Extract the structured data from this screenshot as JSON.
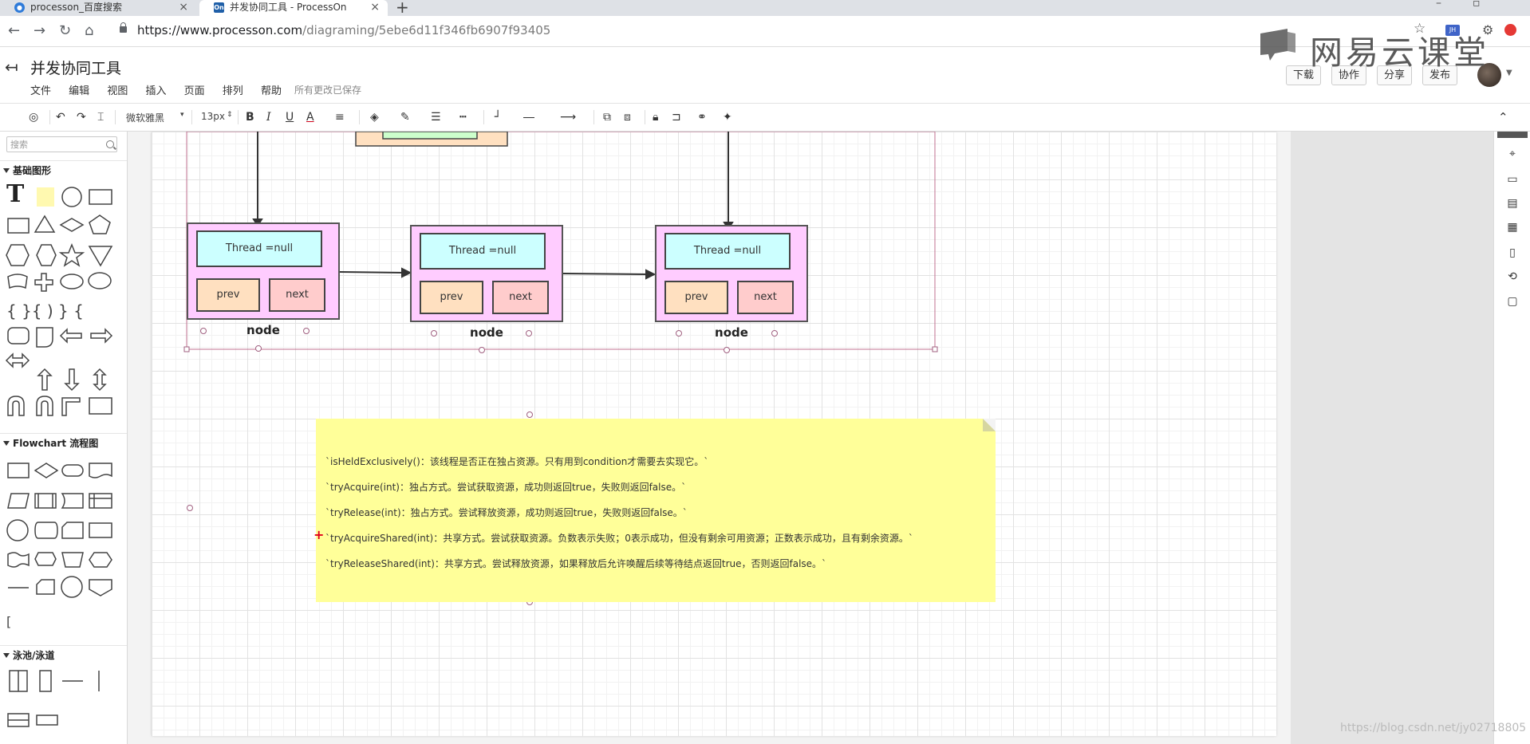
{
  "browser": {
    "tabs": [
      {
        "label": "processon_百度搜索",
        "favicon": "baidu-paw-icon"
      },
      {
        "label": "并发协同工具 - ProcessOn",
        "favicon": "On"
      }
    ],
    "url_host": "https://www.processon.com",
    "url_path": "/diagraming/5ebe6d11f346fb6907f93405",
    "ext_badge": "JH"
  },
  "watermark": {
    "text": "网易云课堂"
  },
  "app": {
    "doc_title": "并发协同工具",
    "menu": [
      "文件",
      "编辑",
      "视图",
      "插入",
      "页面",
      "排列",
      "帮助"
    ],
    "save_status": "所有更改已保存",
    "buttons": {
      "download": "下载",
      "collab": "协作",
      "share": "分享",
      "publish": "发布"
    }
  },
  "toolbar": {
    "font_family": "微软雅黑",
    "font_size": "13px",
    "bold": "B",
    "italic": "I",
    "underline": "U",
    "font_color": "A"
  },
  "sidebar": {
    "search_placeholder": "搜索",
    "sections": {
      "basic": "基础图形",
      "flowchart": "Flowchart 流程图",
      "swimlane": "泳池/泳道"
    }
  },
  "diagram": {
    "nodes": [
      {
        "thread": "Thread =null",
        "prev": "prev",
        "next": "next",
        "label": "node"
      },
      {
        "thread": "Thread =null",
        "prev": "prev",
        "next": "next",
        "label": "node"
      },
      {
        "thread": "Thread =null",
        "prev": "prev",
        "next": "next",
        "label": "node"
      }
    ],
    "note_lines": [
      "`isHeldExclusively()：该线程是否正在独占资源。只有用到condition才需要去实现它。`",
      "`tryAcquire(int)：独占方式。尝试获取资源，成功则返回true，失败则返回false。`",
      "`tryRelease(int)：独占方式。尝试释放资源，成功则返回true，失败则返回false。`",
      "`tryAcquireShared(int)：共享方式。尝试获取资源。负数表示失败；0表示成功，但没有剩余可用资源；正数表示成功，且有剩余资源。`",
      "`tryReleaseShared(int)：共享方式。尝试释放资源，如果释放后允许唤醒后续等待结点返回true，否则返回false。`"
    ]
  },
  "footer": {
    "csdn": "https://blog.csdn.net/jy02718805"
  },
  "colors": {
    "node_fill": "#ffccff",
    "thread_fill": "#ccffff",
    "prev_fill": "#ffe0c0",
    "next_fill": "#ffcccc",
    "note_fill": "#ffff99",
    "selection": "#c07090"
  }
}
